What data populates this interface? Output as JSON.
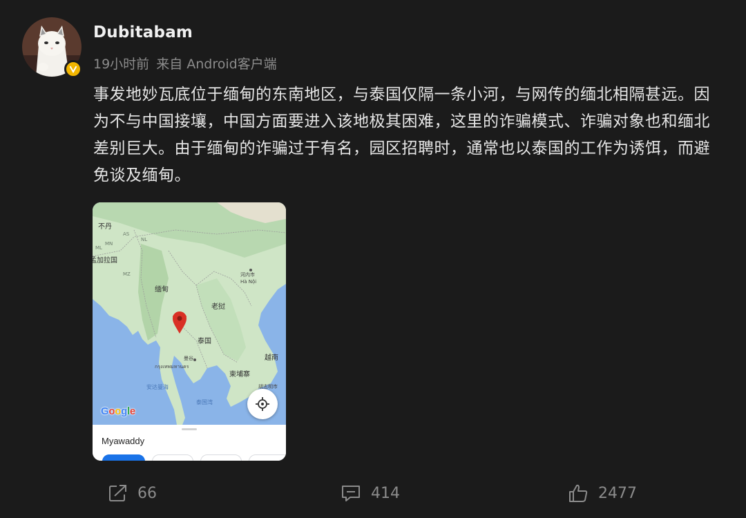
{
  "post": {
    "username": "Dubitabam",
    "time": "19小时前",
    "source": "来自 Android客户端",
    "content": "事发地妙瓦底位于缅甸的东南地区，与泰国仅隔一条小河，与网传的缅北相隔甚远。因为不与中国接壤，中国方面要进入该地极其困难，这里的诈骗模式、诈骗对象也和缅北差别巨大。由于缅甸的诈骗过于有名，园区招聘时，通常也以泰国的工作为诱饵，而避免谈及缅甸。"
  },
  "map": {
    "labels": {
      "nepal": "不丹",
      "as": "AS",
      "nl": "NL",
      "mn": "MN",
      "ml": "ML",
      "bangladesh": "孟加拉国",
      "mz": "MZ",
      "myanmar": "缅甸",
      "hanoi_cn": "河内市",
      "hanoi": "Hà Nội",
      "laos": "老挝",
      "thailand": "泰国",
      "bangkok_cn": "曼谷",
      "bangkok_th": "กรุงเทพมหานคร",
      "vietnam": "越南",
      "cambodia": "柬埔寨",
      "hcmc": "胡志明市",
      "andaman": "安达曼海",
      "gulf": "泰国湾"
    },
    "logo": "Google",
    "place_name": "Myawaddy",
    "marker_color": "#d93025"
  },
  "actions": {
    "share_count": "66",
    "comment_count": "414",
    "like_count": "2477"
  },
  "colors": {
    "background": "#1b1b1b",
    "verified_badge": "#f2b600"
  }
}
